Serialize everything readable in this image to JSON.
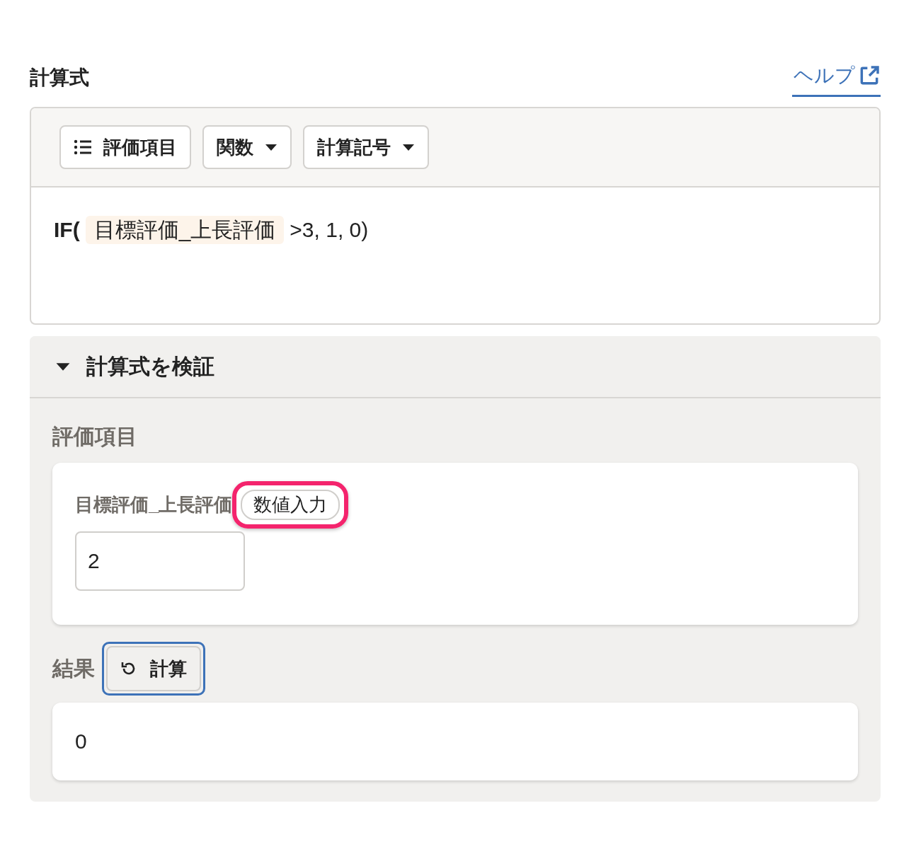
{
  "header": {
    "title": "計算式",
    "help_link": "ヘルプ"
  },
  "toolbar": [
    {
      "kind": "list",
      "label": "評価項目"
    },
    {
      "kind": "dropdown",
      "label": "関数"
    },
    {
      "kind": "dropdown",
      "label": "計算記号"
    }
  ],
  "formula": [
    {
      "kind": "text",
      "text": "IF("
    },
    {
      "kind": "field",
      "text": "目標評価_上長評価"
    },
    {
      "kind": "text",
      "text": ">3, 1, 0)"
    }
  ],
  "verify": {
    "title": "計算式を検証",
    "expanded": true,
    "items_label": "評価項目",
    "items": [
      {
        "label": "目標評価_上長評価",
        "badge": "数値入力",
        "highlighted": true,
        "value": "2"
      }
    ],
    "result_label": "結果",
    "calc_button": {
      "label": "計算",
      "focused": true
    },
    "result": "0"
  }
}
